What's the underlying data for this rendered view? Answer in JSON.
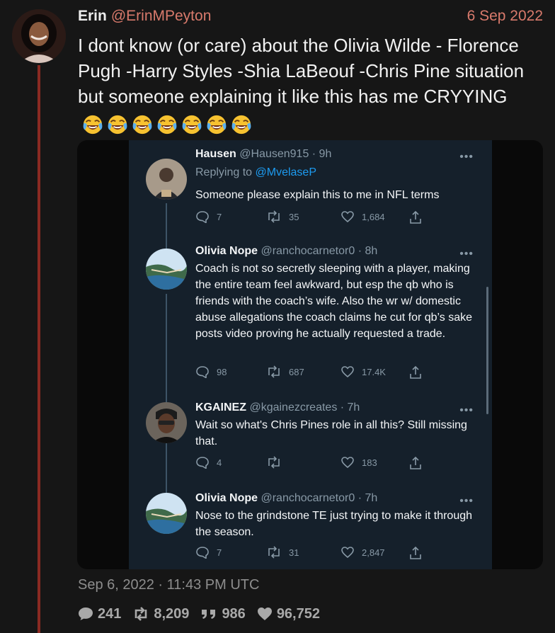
{
  "tweet": {
    "author_name": "Erin",
    "author_handle": "@ErinMPeyton",
    "date": "6 Sep 2022",
    "text": "I dont know (or care) about the Olivia Wilde - Florence Pugh -Harry Styles -Shia LaBeouf -Chris Pine situation but someone explaining it like this has me CRYYING",
    "emoji_count": 7,
    "timestamp": "Sep 6, 2022 · 11:43 PM UTC",
    "stats": {
      "replies": "241",
      "retweets": "8,209",
      "quotes": "986",
      "likes": "96,752"
    }
  },
  "embedded_thread": [
    {
      "name": "Hausen",
      "handle_time": "@Hausen915 · 9h",
      "replying_label": "Replying to",
      "replying_to": "@MvelaseP",
      "body": "Someone please explain this to me in NFL terms",
      "replies": "7",
      "retweets": "35",
      "likes": "1,684"
    },
    {
      "name": "Olivia Nope",
      "handle_time": "@ranchocarnetor0 · 8h",
      "body": "Coach is not so secretly sleeping with a player, making the entire team feel awkward, but esp the qb who is friends with the coach’s wife. Also the wr w/ domestic abuse allegations the coach claims he cut for qb’s sake posts video proving he actually requested a trade.",
      "replies": "98",
      "retweets": "687",
      "likes": "17.4K"
    },
    {
      "name": "KGAINEZ",
      "handle_time": "@kgainezcreates · 7h",
      "body": "Wait so what's Chris Pines role in all this? Still missing that.",
      "replies": "4",
      "retweets": "",
      "likes": "183"
    },
    {
      "name": "Olivia Nope",
      "handle_time": "@ranchocarnetor0 · 7h",
      "body": "Nose to the grindstone TE just trying to make it through the season.",
      "replies": "7",
      "retweets": "31",
      "likes": "2,847"
    }
  ],
  "icons": {
    "reply": "speech-bubble-icon",
    "retweet": "retweet-icon",
    "quote": "quote-icon",
    "like": "heart-icon",
    "share": "share-icon",
    "more": "more-icon",
    "emoji": "face-with-tears-of-joy-icon"
  },
  "colors": {
    "background": "#161616",
    "accent": "#d97a6c",
    "thread_line": "#8a2a22",
    "embedded_bg": "#15202b",
    "link": "#1d9bf0"
  }
}
